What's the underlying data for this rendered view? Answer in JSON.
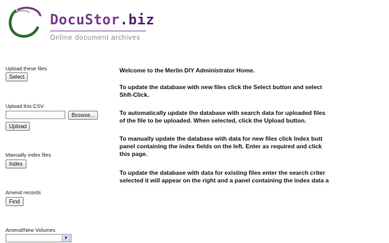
{
  "brand": {
    "name_main": "DocuStor",
    "name_suffix": ".biz",
    "tagline": "Online document archives"
  },
  "sidebar": {
    "upload_files": {
      "label": "Upload these files",
      "button": "Select"
    },
    "upload_csv": {
      "label": "Upload this CSV",
      "file_value": "",
      "browse_button": "Browse...",
      "upload_button": "Upload"
    },
    "manual_index": {
      "label": "Manually index files",
      "button": "Index"
    },
    "amend_records": {
      "label": "Amend records",
      "button": "Find"
    },
    "amend_volumes": {
      "label": "Amend/New Volumes",
      "selected": ""
    }
  },
  "main": {
    "welcome": "Welcome to the Merlin DIY Administrator Home.",
    "para1_line1": "To update the database with new files click the Select button and select",
    "para1_line2": "Shft-Click.",
    "para2_line1": "To automatically update the database with search data for uploaded files",
    "para2_line2": "of the file to be uploaded. When selected, click the Upload button.",
    "para3_line1": "To manually update the database with data for new files click Index butt",
    "para3_line2": "panel containing the index fields on the left. Enter as required and click",
    "para3_line3": "this page.",
    "para4_line1": "To update the database with data for existing files enter the search criter",
    "para4_line2": "selected it will appear on the right and a panel containing the index data a"
  },
  "colors": {
    "brand_purple": "#7a3b8c",
    "logo_green": "#2f6b2a"
  }
}
